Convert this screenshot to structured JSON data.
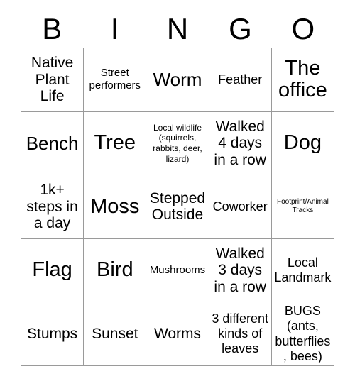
{
  "header": {
    "letters": [
      "B",
      "I",
      "N",
      "G",
      "O"
    ]
  },
  "grid": {
    "rows": 5,
    "columns": 5,
    "border_color": "#9a9a9a",
    "background_color": "#ffffff",
    "text_color": "#000000",
    "cells": [
      {
        "text": "Native Plant Life",
        "size": "lg"
      },
      {
        "text": "Street performers",
        "size": "sm"
      },
      {
        "text": "Worm",
        "size": "xl"
      },
      {
        "text": "Feather",
        "size": "md"
      },
      {
        "text": "The office",
        "size": "xxl"
      },
      {
        "text": "Bench",
        "size": "xl"
      },
      {
        "text": "Tree",
        "size": "xxl"
      },
      {
        "text": "Local wildlife (squirrels, rabbits, deer, lizard)",
        "size": "xs"
      },
      {
        "text": "Walked 4 days in a row",
        "size": "lg"
      },
      {
        "text": "Dog",
        "size": "xxl"
      },
      {
        "text": "1k+ steps in a day",
        "size": "lg"
      },
      {
        "text": "Moss",
        "size": "xxl"
      },
      {
        "text": "Stepped Outside",
        "size": "lg"
      },
      {
        "text": "Coworker",
        "size": "md"
      },
      {
        "text": "Footprint/Animal Tracks",
        "size": "xxs"
      },
      {
        "text": "Flag",
        "size": "xxl"
      },
      {
        "text": "Bird",
        "size": "xxl"
      },
      {
        "text": "Mushrooms",
        "size": "sm"
      },
      {
        "text": "Walked 3 days in a row",
        "size": "lg"
      },
      {
        "text": "Local Landmark",
        "size": "md"
      },
      {
        "text": "Stumps",
        "size": "lg"
      },
      {
        "text": "Sunset",
        "size": "lg"
      },
      {
        "text": "Worms",
        "size": "lg"
      },
      {
        "text": "3 different kinds of leaves",
        "size": "md"
      },
      {
        "text": "BUGS (ants, butterflies, bees)",
        "size": "md"
      }
    ]
  }
}
